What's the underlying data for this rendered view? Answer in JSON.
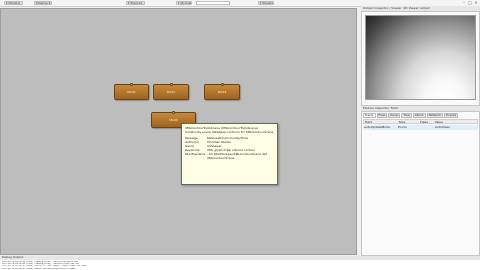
{
  "toolbar": {
    "buttons": [
      {
        "label": "▾ Pipeline"
      },
      {
        "label": "Pipeline ▾"
      },
      {
        "label": "▾ Execute"
      },
      {
        "label": "▾ Modules"
      },
      {
        "label": "▾ Pipeline"
      }
    ],
    "search_placeholder": ""
  },
  "modules": [
    {
      "label": "Mod1"
    },
    {
      "label": "Mod2"
    },
    {
      "label": "Mod3"
    },
    {
      "label": "Mod4"
    }
  ],
  "tooltip": {
    "title": "XMLContourToolsScene (XMLContourToolsScene)",
    "description": "Constructs scene database contours for XMLContourScene.",
    "rows": [
      {
        "key": "Package",
        "value": "MeVisLab/Community/Tools"
      },
      {
        "key": "Author(s)",
        "value": "Christian Rieder"
      },
      {
        "key": "Genre",
        "value": "VolViewer"
      },
      {
        "key": "Keywords",
        "value": "XML glyph draw volume contour"
      },
      {
        "key": "DLL/Filename",
        "value": "..Scripts/Modules/XMLContourScene.def"
      },
      {
        "key": "",
        "value": "XMLContourScene"
      }
    ]
  },
  "output_panel": {
    "title": "Output Inspector / Viewer: 2D Viewer output"
  },
  "inspector": {
    "title": "Module Inspector: Field",
    "tabs": [
      "Fields",
      "Flow",
      "Panel",
      "Tree",
      "About",
      "Network",
      "Events"
    ],
    "columns": [
      "Field",
      "Type",
      "Flags",
      "Value"
    ],
    "row": {
      "field": "autoUpdateMode",
      "type": "Enum",
      "flags": "",
      "value": "AutoClear"
    }
  },
  "log": {
    "title": "Debug Output",
    "lines": [
      {
        "text": "2011-08-18 09:14:44 [INFO] Loading Scene: Contours/AutoWalk.dcm",
        "err": false
      },
      {
        "text": "2011-08-18 09:14:44 [INFO] Loading Scene: Contours/SceneTree.xml",
        "err": false
      },
      {
        "text": "2011-08-18 09:14:45 [WARN] Failed to load images: input image too small",
        "err": true
      },
      {
        "text": "2011-08-18 09:14:46 [INFO] Module XMLContourToolsScene loaded",
        "err": false
      }
    ]
  },
  "colors": {
    "canvas_background": "#bdbdbd",
    "module_fill": "#b37a30",
    "tooltip_background": "#ffffe6"
  }
}
